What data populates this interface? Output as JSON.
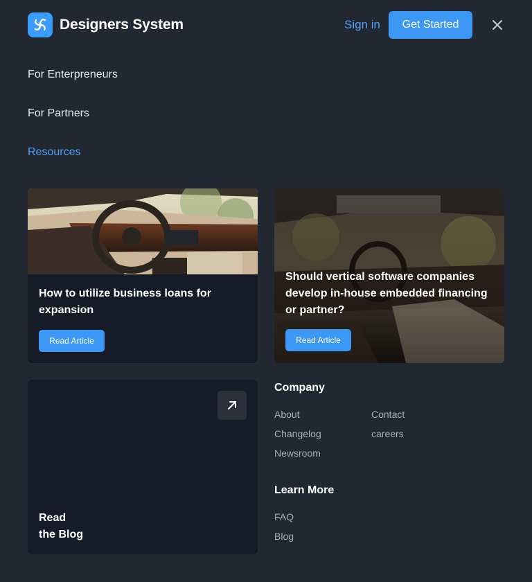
{
  "header": {
    "brand": "Designers System",
    "sign_in": "Sign in",
    "get_started": "Get Started"
  },
  "nav": {
    "items": [
      {
        "label": "For Enterpreneurs"
      },
      {
        "label": "For Partners"
      },
      {
        "label": "Resources"
      }
    ]
  },
  "cards": [
    {
      "title": "How to utilize business loans for expansion",
      "button": "Read Article"
    },
    {
      "title": "Should vertical software companies develop in-house embedded financing or partner?",
      "button": "Read Article"
    }
  ],
  "blog": {
    "line1": "Read",
    "line2": "the Blog"
  },
  "company": {
    "title": "Company",
    "links_col1": [
      "About",
      "Changelog",
      "Newsroom"
    ],
    "links_col2": [
      "Contact",
      "careers"
    ]
  },
  "learn_more": {
    "title": "Learn More",
    "links": [
      "FAQ",
      "Blog"
    ]
  },
  "colors": {
    "background": "#222831",
    "accent": "#3d97f5",
    "link_active": "#4ea1f7",
    "card": "#151a27"
  },
  "icons": [
    "logo-icon",
    "close-icon",
    "arrow-up-right-icon"
  ]
}
